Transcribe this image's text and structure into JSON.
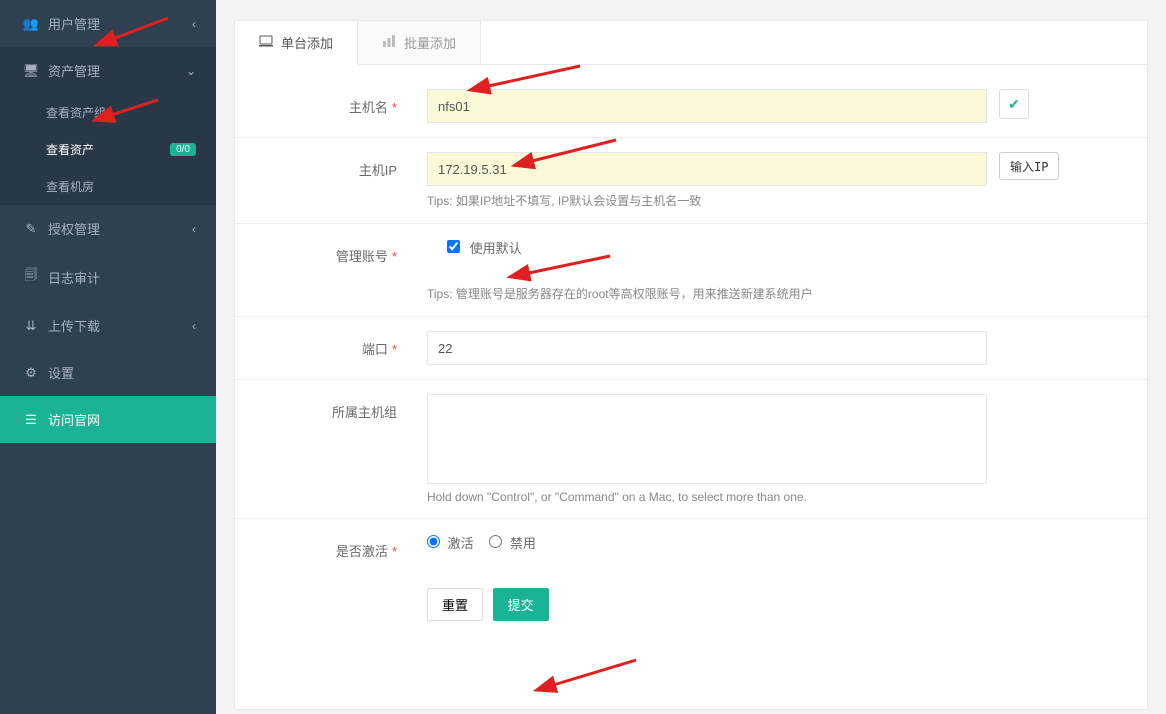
{
  "sidebar": {
    "items": [
      {
        "icon": "👥",
        "label": "用户管理"
      },
      {
        "icon": "🖥",
        "label": "资产管理",
        "open": true,
        "children": [
          {
            "label": "查看资产组"
          },
          {
            "label": "查看资产",
            "badge": "0/0",
            "active": true
          },
          {
            "label": "查看机房"
          }
        ]
      },
      {
        "icon": "✎",
        "label": "授权管理"
      },
      {
        "icon": "🗐",
        "label": "日志审计"
      },
      {
        "icon": "⇊",
        "label": "上传下载"
      },
      {
        "icon": "⚙",
        "label": "设置"
      },
      {
        "icon": "☰",
        "label": "访问官网",
        "visit": true
      }
    ]
  },
  "tabs": {
    "single": {
      "icon": "laptop",
      "label": "单台添加"
    },
    "batch": {
      "icon": "chart",
      "label": "批量添加"
    }
  },
  "form": {
    "hostname": {
      "label": "主机名",
      "value": "nfs01"
    },
    "hostip": {
      "label": "主机IP",
      "value": "172.19.5.31",
      "btn": "输入IP",
      "tip": "Tips: 如果IP地址不填写, IP默认会设置与主机名一致"
    },
    "admin": {
      "label": "管理账号",
      "chk_label": "使用默认",
      "tip": "Tips: 管理账号是服务器存在的root等高权限账号，用来推送新建系统用户"
    },
    "port": {
      "label": "端口",
      "value": "22"
    },
    "group": {
      "label": "所属主机组",
      "tip": "Hold down \"Control\", or \"Command\" on a Mac, to select more than one."
    },
    "active": {
      "label": "是否激活",
      "opt_on": "激活",
      "opt_off": "禁用"
    },
    "buttons": {
      "reset": "重置",
      "submit": "提交"
    }
  }
}
